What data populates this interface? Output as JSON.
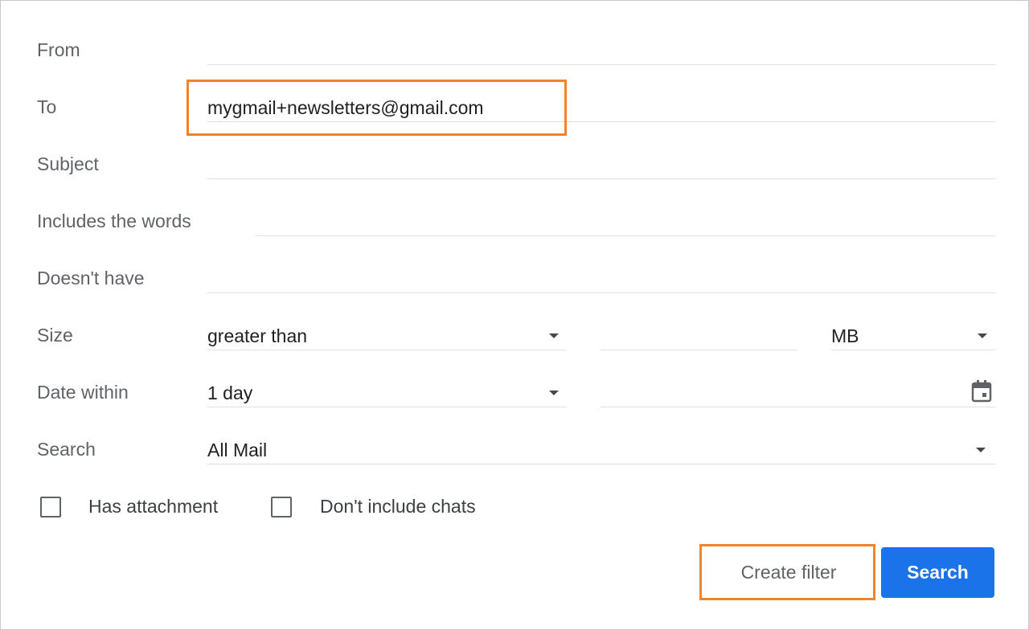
{
  "form": {
    "from": {
      "label": "From",
      "value": ""
    },
    "to": {
      "label": "To",
      "value": "mygmail+newsletters@gmail.com"
    },
    "subject": {
      "label": "Subject",
      "value": ""
    },
    "includes": {
      "label": "Includes the words",
      "value": ""
    },
    "doesnt_have": {
      "label": "Doesn't have",
      "value": ""
    },
    "size": {
      "label": "Size",
      "comparator": "greater than",
      "amount": "",
      "unit": "MB"
    },
    "date_within": {
      "label": "Date within",
      "range": "1 day",
      "date": ""
    },
    "search": {
      "label": "Search",
      "scope": "All Mail"
    },
    "has_attachment": {
      "label": "Has attachment",
      "checked": false
    },
    "dont_include_chats": {
      "label": "Don't include chats",
      "checked": false
    }
  },
  "actions": {
    "create_filter": "Create filter",
    "search": "Search"
  },
  "icons": {
    "dropdown": "chevron-down-icon",
    "calendar": "calendar-icon"
  },
  "colors": {
    "highlight": "#f0842a",
    "primary_button": "#1a73e8",
    "label_text": "#5f6368",
    "value_text": "#202124"
  }
}
